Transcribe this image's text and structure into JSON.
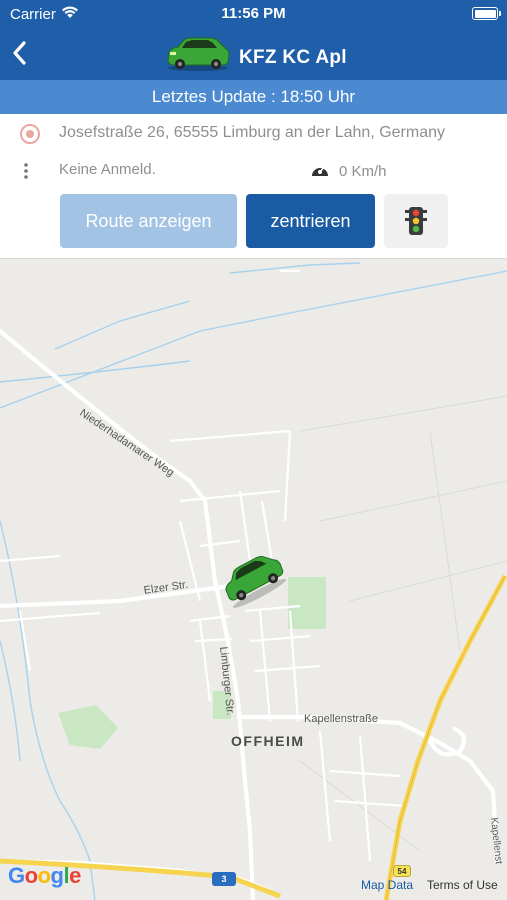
{
  "status_bar": {
    "carrier": "Carrier",
    "time": "11:56 PM"
  },
  "header": {
    "title": "KFZ KC Apl"
  },
  "update_bar": {
    "text": "Letztes Update : 18:50 Uhr"
  },
  "info": {
    "address": "Josefstraße 26, 65555 Limburg an der Lahn, Germany",
    "login_status": "Keine Anmeld.",
    "speed": "0 Km/h"
  },
  "buttons": {
    "route": "Route anzeigen",
    "center": "zentrieren"
  },
  "map": {
    "labels": {
      "niederhadamarer": "Niederhadamarer Weg",
      "elzer": "Elzer Str.",
      "limburger": "Limburger Str.",
      "kapellenstrasse": "Kapellenstraße",
      "offheim": "OFFHEIM",
      "kapellenst_short": "Kapellenst"
    },
    "shields": {
      "b54": "54",
      "a3": "3"
    },
    "google": [
      "G",
      "o",
      "o",
      "g",
      "l",
      "e"
    ],
    "map_data_link": "Map Data",
    "terms_link": "Terms of Use"
  },
  "colors": {
    "primary": "#1f5fa9",
    "update_bar": "#4b8ad0",
    "button_disabled": "#a3c3e4",
    "button_active": "#1a5ca3",
    "car_green": "#3aa637",
    "map_background": "#ecebe7"
  },
  "icons": {
    "back": "chevron-left-icon",
    "car": "car-icon",
    "location": "location-pin-icon",
    "menu": "more-vertical-icon",
    "speedometer": "speedometer-icon",
    "traffic": "traffic-light-icon"
  }
}
